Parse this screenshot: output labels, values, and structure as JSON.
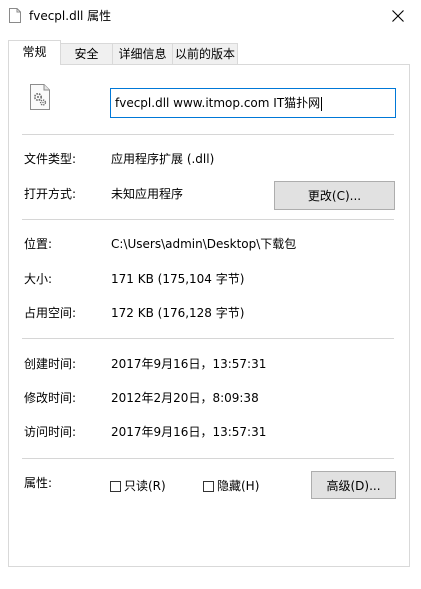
{
  "window": {
    "title": "fvecpl.dll 属性",
    "title_icon": "file-icon",
    "close_icon": "close-icon"
  },
  "tabs": [
    {
      "label": "常规",
      "active": true
    },
    {
      "label": "安全"
    },
    {
      "label": "详细信息"
    },
    {
      "label": "以前的版本"
    }
  ],
  "general": {
    "file_name": "fvecpl.dll  www.itmop.com IT猫扑网",
    "file_type_label": "文件类型:",
    "file_type_value": "应用程序扩展 (.dll)",
    "open_with_label": "打开方式:",
    "open_with_value": "未知应用程序",
    "change_button": "更改(C)...",
    "location_label": "位置:",
    "location_value": "C:\\Users\\admin\\Desktop\\下载包",
    "size_label": "大小:",
    "size_value": "171 KB (175,104 字节)",
    "size_on_disk_label": "占用空间:",
    "size_on_disk_value": "172 KB (176,128 字节)",
    "created_label": "创建时间:",
    "created_value": "2017年9月16日，13:57:31",
    "modified_label": "修改时间:",
    "modified_value": "2012年2月20日，8:09:38",
    "accessed_label": "访问时间:",
    "accessed_value": "2017年9月16日，13:57:31",
    "attributes_label": "属性:",
    "readonly_label": "只读(R)",
    "readonly_checked": false,
    "hidden_label": "隐藏(H)",
    "hidden_checked": false,
    "advanced_button": "高级(D)..."
  }
}
